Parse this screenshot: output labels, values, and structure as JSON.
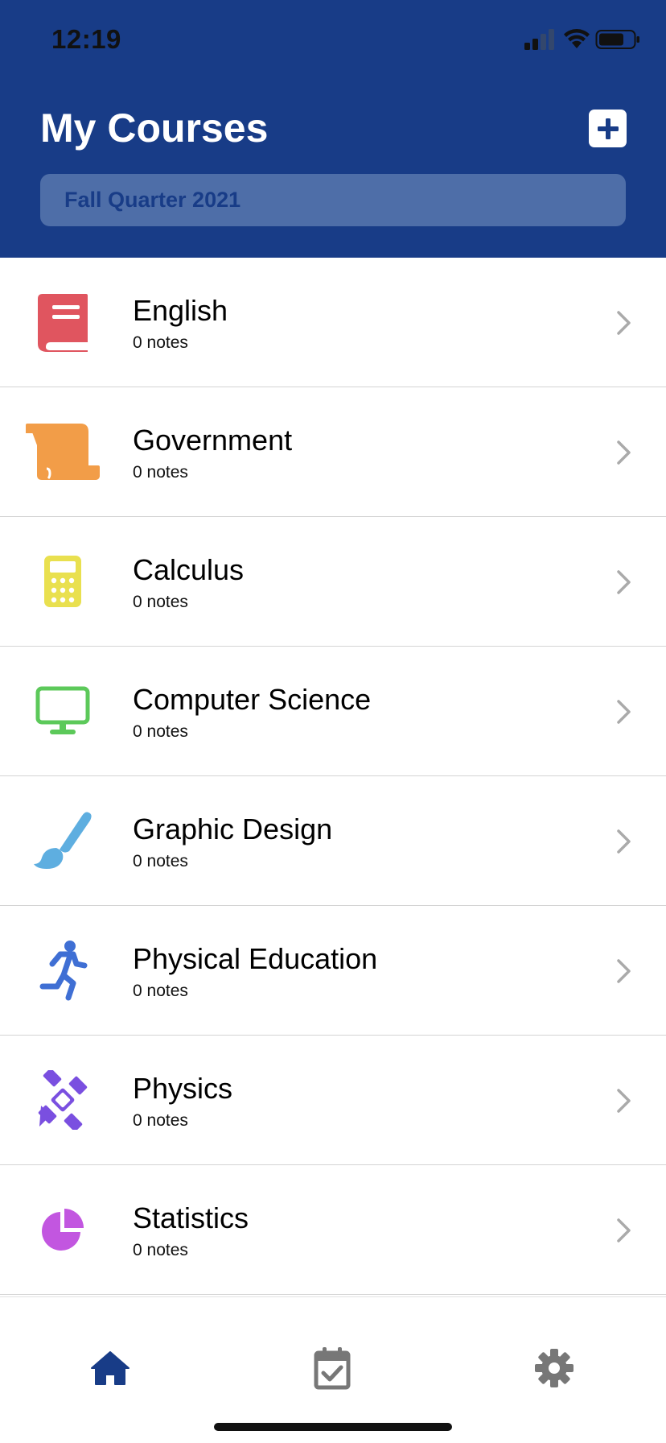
{
  "status_bar": {
    "time": "12:19"
  },
  "header": {
    "title": "My Courses",
    "search_placeholder": "Fall Quarter 2021",
    "add_icon": "plus-square-icon"
  },
  "courses": [
    {
      "name": "English",
      "notes": "0 notes",
      "icon": "book-icon",
      "color": "#e0555f"
    },
    {
      "name": "Government",
      "notes": "0 notes",
      "icon": "scroll-icon",
      "color": "#f29d48"
    },
    {
      "name": "Calculus",
      "notes": "0 notes",
      "icon": "calculator-icon",
      "color": "#e9e04f"
    },
    {
      "name": "Computer Science",
      "notes": "0 notes",
      "icon": "desktop-icon",
      "color": "#5cc95a"
    },
    {
      "name": "Graphic Design",
      "notes": "0 notes",
      "icon": "paintbrush-icon",
      "color": "#5eaee0"
    },
    {
      "name": "Physical Education",
      "notes": "0 notes",
      "icon": "running-icon",
      "color": "#3f6fd4"
    },
    {
      "name": "Physics",
      "notes": "0 notes",
      "icon": "satellite-icon",
      "color": "#7a4fe0"
    },
    {
      "name": "Statistics",
      "notes": "0 notes",
      "icon": "pie-chart-icon",
      "color": "#c256e0"
    }
  ],
  "tab_bar": {
    "tabs": [
      {
        "name": "home",
        "icon": "home-icon",
        "active": true,
        "color": "#183c87"
      },
      {
        "name": "calendar",
        "icon": "calendar-check-icon",
        "active": false,
        "color": "#777777"
      },
      {
        "name": "settings",
        "icon": "gear-icon",
        "active": false,
        "color": "#777777"
      }
    ]
  },
  "colors": {
    "header_bg": "#183c87",
    "search_bg": "#4e6ea8",
    "chevron": "#aaaaaa"
  }
}
